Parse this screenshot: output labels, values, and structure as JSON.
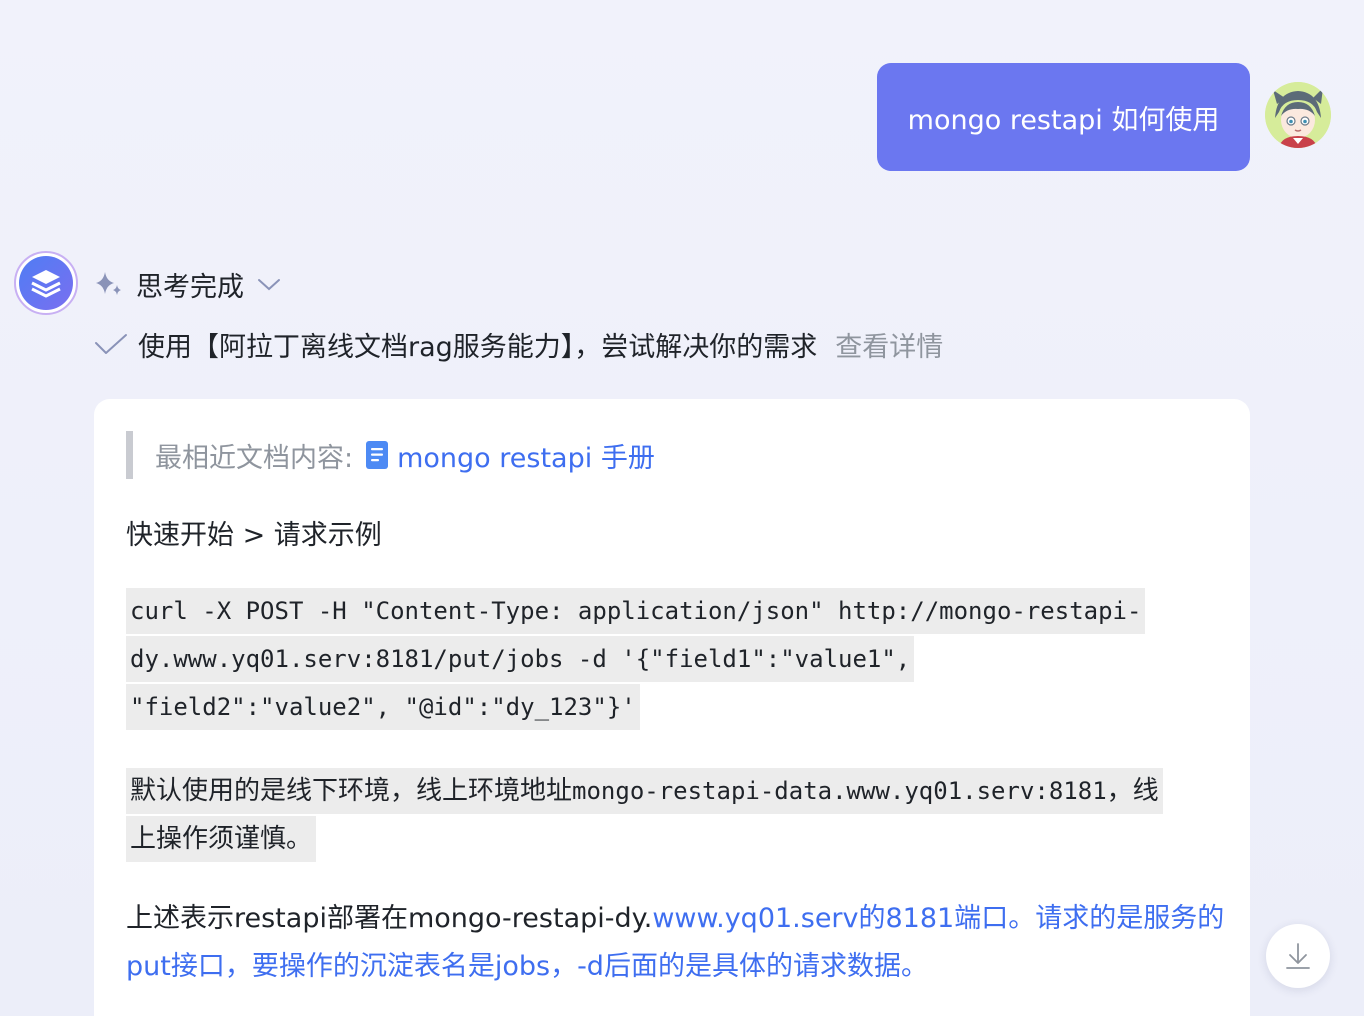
{
  "user_message": {
    "text": "mongo restapi 如何使用"
  },
  "assistant": {
    "thinking_status": "思考完成",
    "tool_usage": "使用【阿拉丁离线文档rag服务能力】，尝试解决你的需求",
    "view_details_label": "查看详情",
    "reference": {
      "label": "最相近文档内容:",
      "doc_title": "mongo restapi 手册"
    },
    "section_title": "快速开始 > 请求示例",
    "code": "curl -X POST -H \"Content-Type: application/json\" http://mongo-restapi-dy.www.yq01.serv:8181/put/jobs -d '{\"field1\":\"value1\", \"field2\":\"value2\", \"@id\":\"dy_123\"}'",
    "env_note": {
      "prefix": "默认使用的是线下环境，线上环境地址",
      "address": "mongo-restapi-data.www.yq01.serv:8181",
      "suffix": "，线上操作须谨慎。"
    },
    "explanation": {
      "plain": "上述表示restapi部署在mongo-restapi-dy.",
      "linked": "www.yq01.serv的8181端口。请求的是服务的put接口，要操作的沉淀表名是jobs，-d后面的是具体的请求数据。"
    }
  },
  "icons": {
    "thinking": "sparkle-icon",
    "expand": "chevron-down-icon",
    "done": "check-icon",
    "document": "document-icon",
    "scroll_down": "download-arrow-icon"
  },
  "colors": {
    "user_bubble": "#6b77f0",
    "link": "#3e6ef0",
    "background": "#eff1fb"
  }
}
